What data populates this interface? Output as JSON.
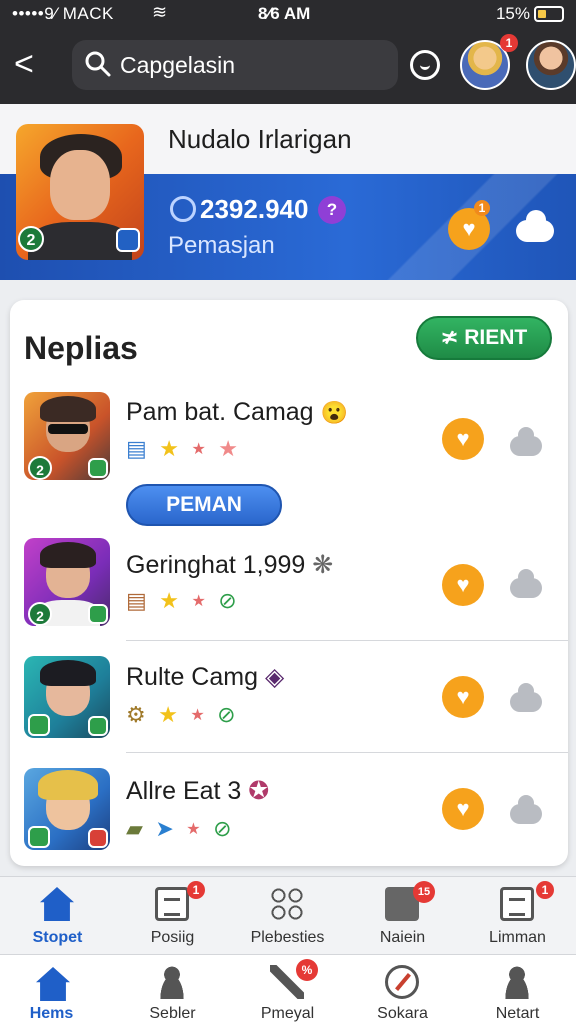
{
  "status": {
    "carrier": "•••••9⁄ MACK",
    "time": "8⁄6 AM",
    "battery": "15%"
  },
  "nav": {
    "back_label": "<",
    "search_value": "Capgelasin",
    "avatar_badge": "1"
  },
  "profile": {
    "name": "Nudalo Irlarigan",
    "level": "2",
    "coins": "2392.940",
    "gem_label": "?",
    "subtitle": "Pemasjan",
    "heart_badge": "1"
  },
  "card": {
    "title": "Neplias",
    "rent_button": "RIENT",
    "rent_icon": "≭",
    "items": [
      {
        "title": "Pam bat. Camag",
        "emoji": "😮",
        "level": "2",
        "action": "PEMAN"
      },
      {
        "title": "Geringhat 1,999",
        "emoji": "❋",
        "level": "2"
      },
      {
        "title": "Rulte Camg",
        "emoji": "◈",
        "level": ""
      },
      {
        "title": "Allre Eat 3",
        "emoji": "✪",
        "level": ""
      }
    ]
  },
  "tabs_top": [
    {
      "label": "Stopet",
      "icon": "house-icon",
      "badge": ""
    },
    {
      "label": "Posiig",
      "icon": "document-icon",
      "badge": "1"
    },
    {
      "label": "Plebesties",
      "icon": "grid-dots-icon",
      "badge": ""
    },
    {
      "label": "Naiein",
      "icon": "box-icon",
      "badge": "15"
    },
    {
      "label": "Limman",
      "icon": "document-icon",
      "badge": "1"
    }
  ],
  "tabs_bottom": [
    {
      "label": "Hems",
      "icon": "house-icon"
    },
    {
      "label": "Sebler",
      "icon": "person-icon"
    },
    {
      "label": "Pmeyal",
      "icon": "pen-icon",
      "badge": "%"
    },
    {
      "label": "Sokara",
      "icon": "compass-icon"
    },
    {
      "label": "Netart",
      "icon": "person-icon"
    }
  ],
  "colors": {
    "accent_blue": "#1f5fc8",
    "rent_green": "#1f8b46",
    "heart_orange": "#f6a21c",
    "badge_red": "#e53935"
  }
}
